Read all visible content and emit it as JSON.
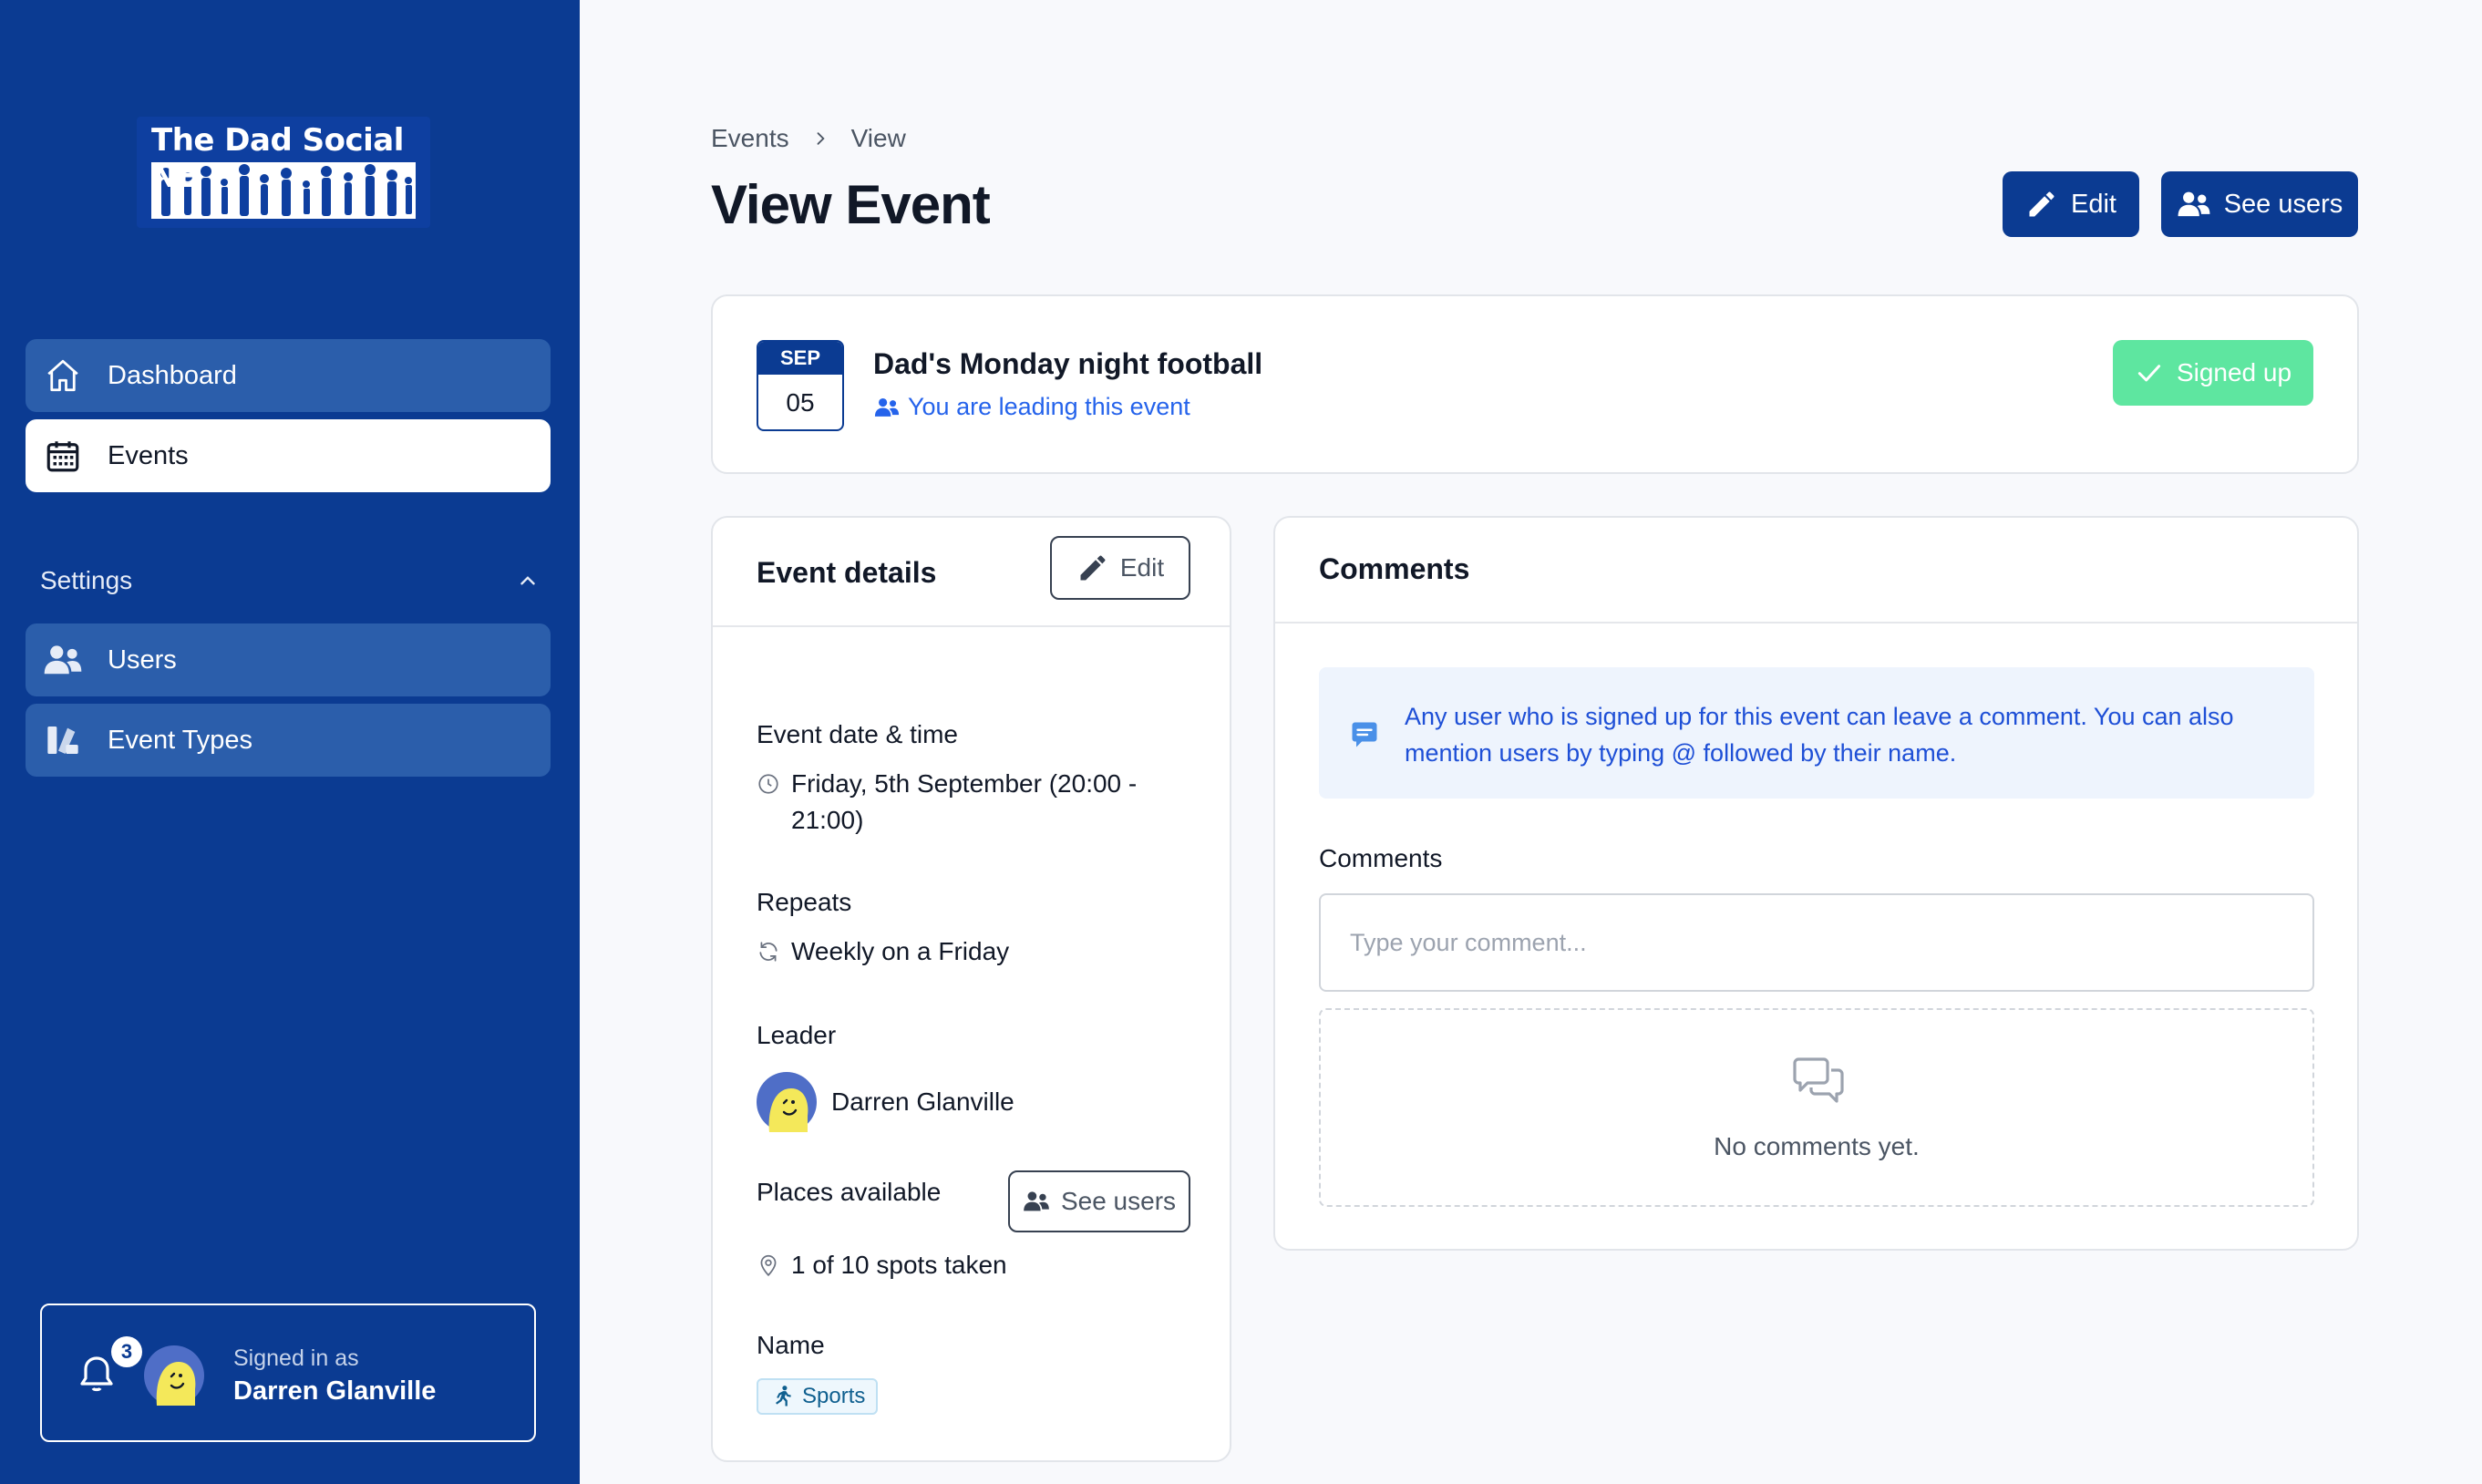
{
  "sidebar": {
    "logo_text": "The Dad Social NE",
    "nav": [
      {
        "label": "Dashboard"
      },
      {
        "label": "Events"
      }
    ],
    "settings_label": "Settings",
    "settings_items": [
      {
        "label": "Users"
      },
      {
        "label": "Event Types"
      }
    ],
    "notifications_count": "3",
    "signed_in_label": "Signed in as",
    "user_name": "Darren Glanville"
  },
  "breadcrumb": {
    "items": [
      "Events",
      "View"
    ]
  },
  "page": {
    "title": "View Event",
    "edit_label": "Edit",
    "see_users_label": "See users"
  },
  "event": {
    "month": "SEP",
    "day": "05",
    "title": "Dad's Monday night football",
    "leading_text": "You are leading this event",
    "signed_up_label": "Signed up"
  },
  "details": {
    "title": "Event details",
    "edit_label": "Edit",
    "date_label": "Event date & time",
    "date_line1": "Friday, 5th September (20:00 -",
    "date_line2": "21:00)",
    "repeats_label": "Repeats",
    "repeats_value": "Weekly on a Friday",
    "leader_label": "Leader",
    "leader_name": "Darren Glanville",
    "places_label": "Places available",
    "see_users_label": "See users",
    "places_value": "1 of 10 spots taken",
    "name_label": "Name",
    "name_tag": "Sports"
  },
  "comments": {
    "title": "Comments",
    "info_text": "Any user who is signed up for this event can leave a comment. You can also mention users by typing @ followed by their name.",
    "field_label": "Comments",
    "placeholder": "Type your comment...",
    "empty_text": "No comments yet."
  },
  "colors": {
    "sidebar_bg": "#0b3b92",
    "nav_item_bg": "#2b5eab",
    "primary": "#0b3b92",
    "signed_up_bg": "#5ee6a0",
    "link_blue": "#2563eb",
    "info_bg": "#eef4fd"
  },
  "icons": {
    "dashboard": "house-icon",
    "events": "calendar-icon",
    "users": "users-icon",
    "event_types": "shapes-icon",
    "notifications": "bell-icon",
    "edit": "pencil-icon",
    "see_users": "users-icon",
    "signed_up": "check-icon",
    "date": "clock-icon",
    "repeats": "refresh-icon",
    "places": "map-pin-icon",
    "tag": "running-icon",
    "info": "chat-bubble-icon",
    "empty": "chat-bubbles-icon"
  }
}
